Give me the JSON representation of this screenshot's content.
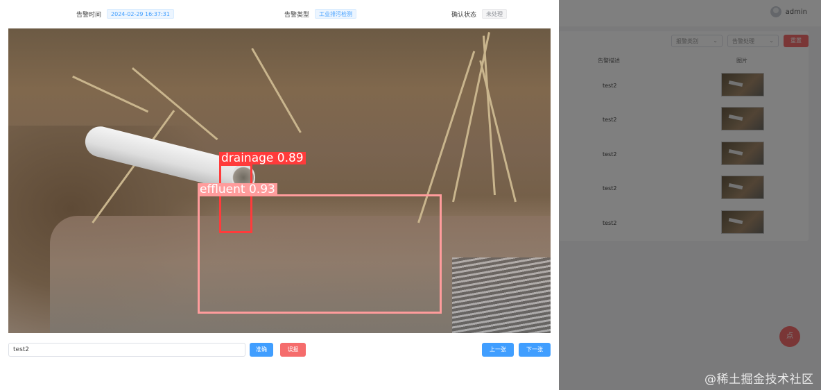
{
  "background_page": {
    "user": {
      "name": "admin",
      "icon": "user-avatar-icon"
    },
    "filters": [
      {
        "label": "报警类别"
      },
      {
        "label": "告警处理"
      }
    ],
    "reset_button": "重置",
    "table": {
      "headers": [
        "告警描述",
        "图片"
      ],
      "rows": [
        {
          "description": "test2"
        },
        {
          "description": "test2"
        },
        {
          "description": "test2"
        },
        {
          "description": "test2"
        },
        {
          "description": "test2"
        }
      ]
    },
    "fab_label": "点",
    "watermark": "@稀土掘金技术社区"
  },
  "dialog": {
    "alarm_time": {
      "label": "告警时间",
      "value": "2024-02-29 16:37:31"
    },
    "alarm_type": {
      "label": "告警类型",
      "value": "工业排污检测"
    },
    "confirm_status": {
      "label": "确认状态",
      "value": "未处理"
    },
    "detections": [
      {
        "label": "drainage 0.89",
        "class": "drainage",
        "score": 0.89,
        "color": "#ff3b3b"
      },
      {
        "label": "effluent 0.93",
        "class": "effluent",
        "score": 0.93,
        "color": "#ff9c9c"
      }
    ],
    "remark": {
      "value": "test2",
      "placeholder": ""
    },
    "buttons": {
      "accurate": "准确",
      "false_alarm": "误报",
      "previous": "上一张",
      "next": "下一张"
    }
  },
  "colors": {
    "primary": "#409eff",
    "danger": "#f56c6c",
    "overlay": "rgba(0,0,0,0.5)"
  }
}
